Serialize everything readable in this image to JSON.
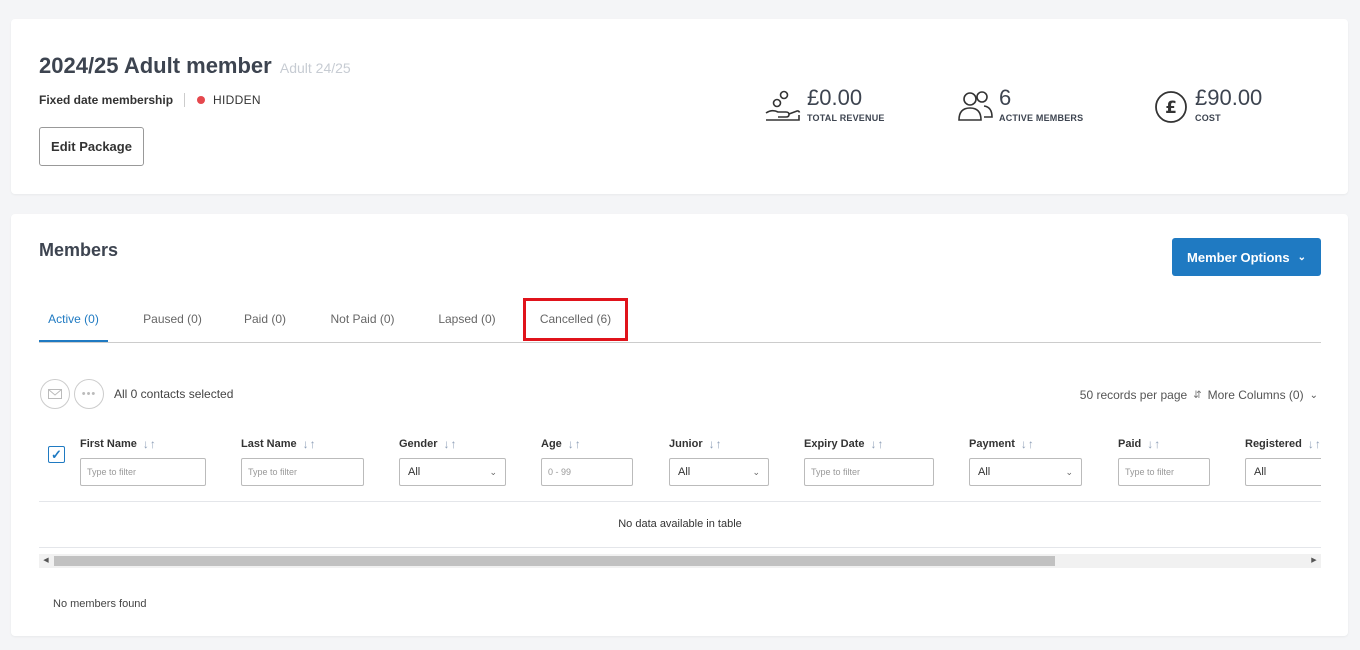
{
  "package": {
    "title": "2024/25 Adult member",
    "subtitle": "Adult 24/25",
    "type": "Fixed date membership",
    "status": "HIDDEN",
    "edit_label": "Edit Package"
  },
  "stats": {
    "revenue": {
      "value": "£0.00",
      "label": "TOTAL REVENUE",
      "icon": "hand-coins-icon"
    },
    "members": {
      "value": "6",
      "label": "ACTIVE MEMBERS",
      "icon": "users-icon"
    },
    "cost": {
      "value": "£90.00",
      "label": "COST",
      "icon": "pound-circle-icon"
    }
  },
  "members": {
    "title": "Members",
    "options_label": "Member Options",
    "tabs": [
      {
        "label": "Active (0)"
      },
      {
        "label": "Paused (0)"
      },
      {
        "label": "Paid (0)"
      },
      {
        "label": "Not Paid (0)"
      },
      {
        "label": "Lapsed (0)"
      },
      {
        "label": "Cancelled (6)"
      }
    ],
    "selected_text": "All 0 contacts selected",
    "per_page": "50 records per page",
    "more_columns": "More Columns (0)",
    "columns": [
      {
        "label": "First Name",
        "placeholder": "Type to filter"
      },
      {
        "label": "Last Name",
        "placeholder": "Type to filter"
      },
      {
        "label": "Gender",
        "selected": "All"
      },
      {
        "label": "Age",
        "placeholder": "0 - 99"
      },
      {
        "label": "Junior",
        "selected": "All"
      },
      {
        "label": "Expiry Date",
        "placeholder": "Type to filter"
      },
      {
        "label": "Payment",
        "selected": "All"
      },
      {
        "label": "Paid",
        "placeholder": "Type to filter"
      },
      {
        "label": "Registered",
        "selected": "All"
      }
    ],
    "empty_text": "No data available in table",
    "no_members_text": "No members found"
  },
  "colors": {
    "accent": "#1f7ac2",
    "highlight": "#e0131b",
    "status_hidden": "#e5484d"
  }
}
